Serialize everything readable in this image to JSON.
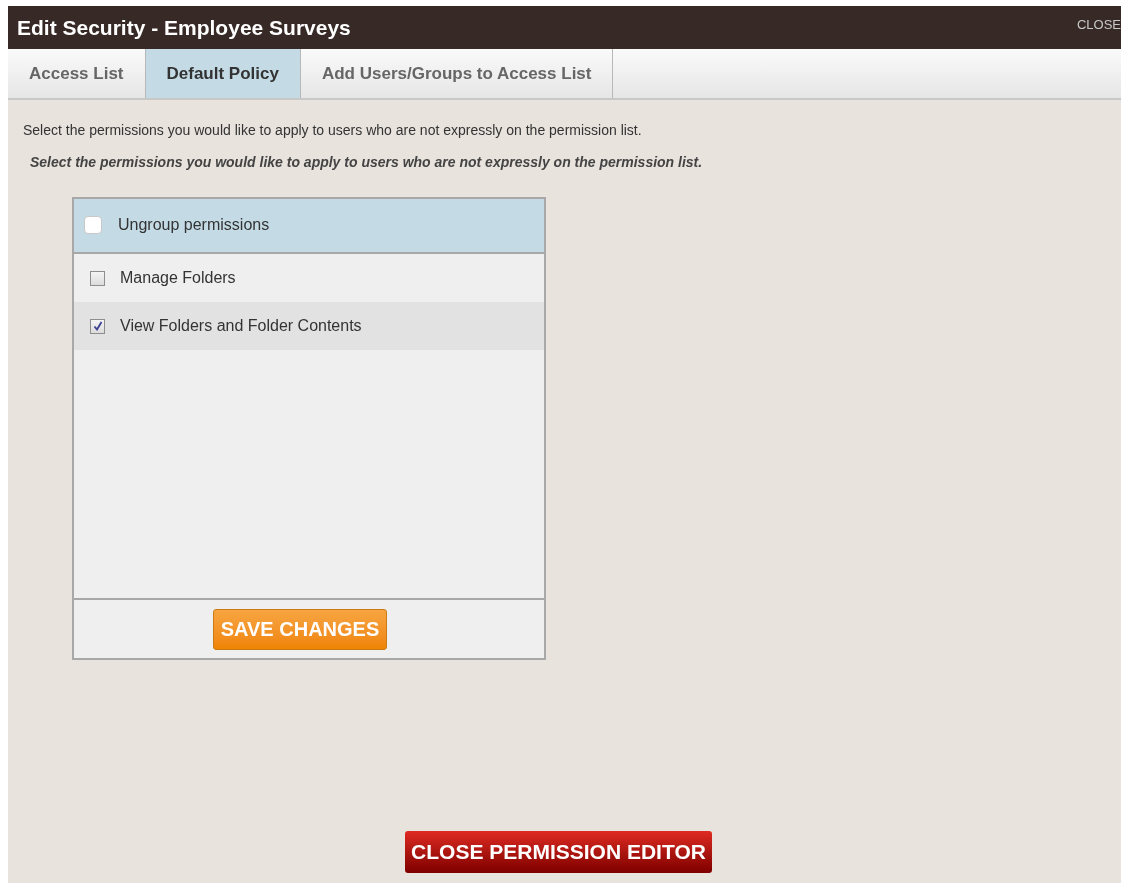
{
  "window": {
    "title": "Edit Security - Employee Surveys",
    "close": "CLOSE"
  },
  "tabs": [
    {
      "label": "Access List",
      "selected": false
    },
    {
      "label": "Default Policy",
      "selected": true
    },
    {
      "label": "Add Users/Groups to Access List",
      "selected": false
    }
  ],
  "instructions": "Select the permissions you would like to apply to users who are not expressly on the permission list.",
  "instructions_emphasis": "Select the permissions you would like to apply to users who are not expressly on the permission list.",
  "ungroup": {
    "label": "Ungroup permissions",
    "checked": false
  },
  "permissions": [
    {
      "label": "Manage Folders",
      "checked": false
    },
    {
      "label": "View Folders and Folder Contents",
      "checked": true
    }
  ],
  "save_button": "SAVE CHANGES",
  "close_button": "CLOSE PERMISSION EDITOR"
}
